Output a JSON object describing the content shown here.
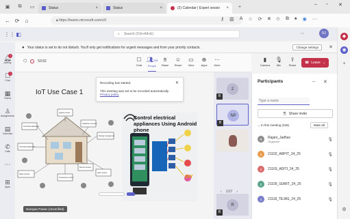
{
  "browser": {
    "tabs": [
      {
        "label": "Status"
      },
      {
        "label": "Status"
      },
      {
        "label": "(2) Calendar | Expert sessio"
      }
    ],
    "url": "https://teams.microsoft.com/v2/"
  },
  "teams": {
    "search_placeholder": "Search (Ctrl+Alt+E)",
    "avatar_initials": "RJ"
  },
  "banner": {
    "text": "Your status is set to do not disturb. You'll only get notifications for urgent messages and from your priority contacts.",
    "change_settings": "Change settings"
  },
  "rail": [
    {
      "label": "Activity"
    },
    {
      "label": "Chat"
    },
    {
      "label": "Teams"
    },
    {
      "label": "Assignments"
    },
    {
      "label": "Calendar"
    },
    {
      "label": "Calls"
    },
    {
      "label": "Apps"
    }
  ],
  "meeting": {
    "timer": "53:52",
    "tools": [
      {
        "label": "Chat"
      },
      {
        "label": "People",
        "count": "228"
      },
      {
        "label": "Raise"
      },
      {
        "label": "React"
      },
      {
        "label": "View"
      },
      {
        "label": "Apps"
      },
      {
        "label": "More"
      },
      {
        "label": "Camera"
      },
      {
        "label": "Mic"
      },
      {
        "label": "Share"
      }
    ],
    "leave_label": "Leave"
  },
  "stage": {
    "slide_title": "IoT Use Case 1",
    "toast": {
      "title": "Recording has started.",
      "body": "This meeting was set to be recorded automatically.",
      "link": "Privacy policy"
    },
    "control_title": "Control electrical appliances Using Android phone",
    "diy_label": "DIY",
    "presenter_label": "Narayan Pawar (Unverified)",
    "diagram_labels": [
      "Controlled appliances",
      "Lighting control",
      "Healthcare cameras",
      "Storage management",
      "Controlled appliances",
      "Remote devices",
      "Window controllers",
      "Tablet controls",
      "Temperature control",
      "Alarm system"
    ]
  },
  "videos": {
    "tiles": [
      {
        "label": "2"
      },
      {
        "label": "NP"
      },
      {
        "label": ""
      },
      {
        "label": "R"
      }
    ],
    "pager": "1/17"
  },
  "participants": {
    "title": "Participants",
    "search_placeholder": "Type a name",
    "share_invite": "Share invite",
    "in_meeting": "In this meeting (228)",
    "mute_all": "Mute all",
    "people": [
      {
        "initial": "R",
        "name": "Rajani_Jadhav",
        "role": "Organizer",
        "color": "#8e8e8e"
      },
      {
        "initial": "2",
        "name": "21102_ARPIT_24_25",
        "role": "",
        "color": "#e89a4f"
      },
      {
        "initial": "2",
        "name": "21103_ADITI_24_25",
        "role": "",
        "color": "#d96b6b"
      },
      {
        "initial": "2",
        "name": "21109_SUMIT_24_25",
        "role": "",
        "color": "#5aa58a"
      },
      {
        "initial": "2",
        "name": "21118_TEJAS_24_25",
        "role": "",
        "color": "#7a7ec9"
      }
    ]
  },
  "colors": {
    "accent": "#5b5fc7",
    "leave": "#c4314b"
  }
}
